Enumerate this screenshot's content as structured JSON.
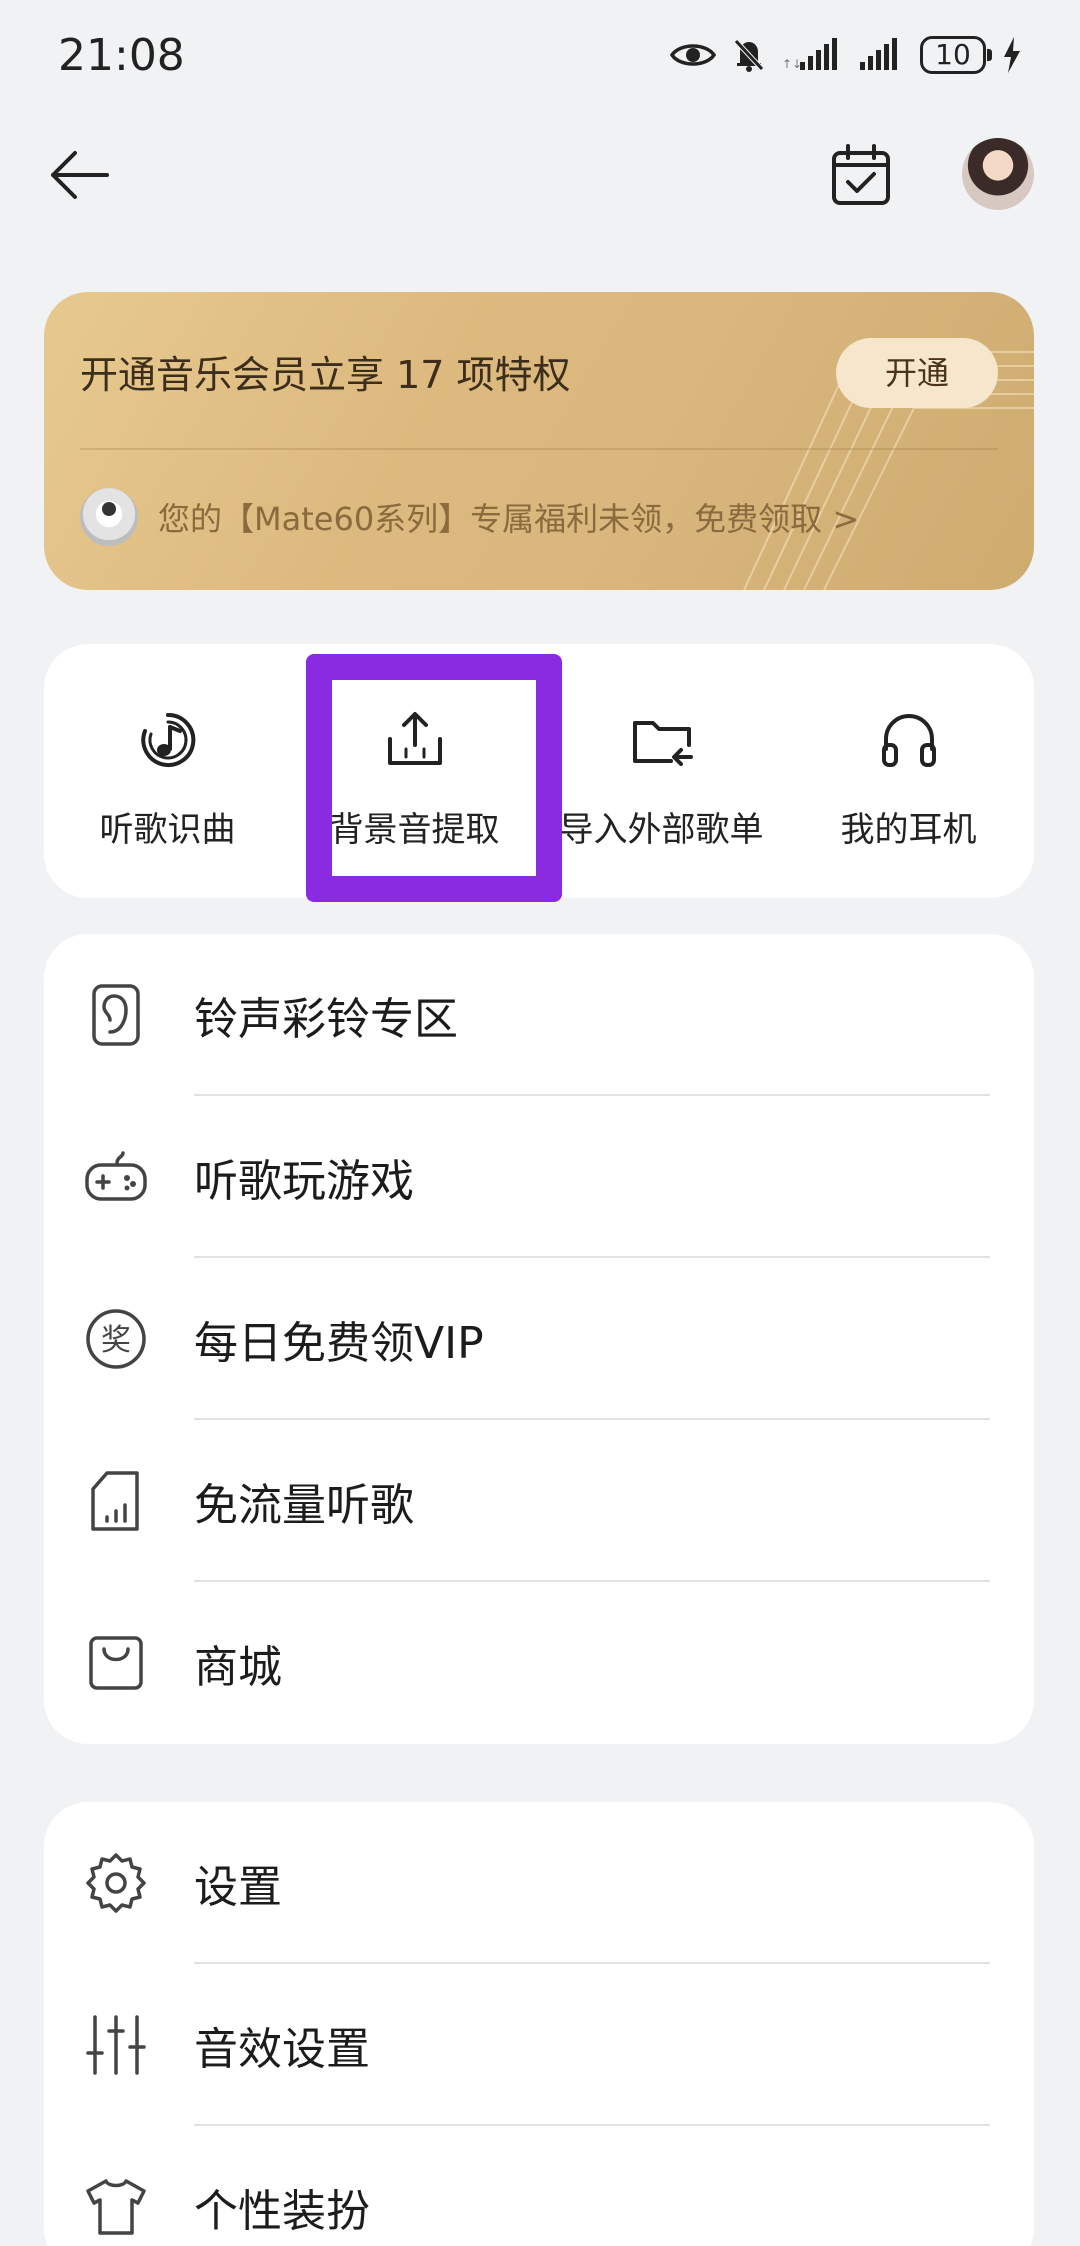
{
  "status_bar": {
    "time": "21:08",
    "battery": "10",
    "icons": [
      "eye-icon",
      "mute-bell-icon",
      "signal-icon",
      "signal-icon",
      "battery-icon",
      "charging-icon"
    ]
  },
  "top_bar": {
    "icons": [
      "back-arrow-icon",
      "calendar-check-icon",
      "avatar"
    ]
  },
  "vip_banner": {
    "title": "开通音乐会员立享 17 项特权",
    "open_button": "开通",
    "promo_text": "您的【Mate60系列】专属福利未领，免费领取 >"
  },
  "quick_actions": [
    {
      "label": "听歌识曲",
      "icon": "music-recognize-icon"
    },
    {
      "label": "背景音提取",
      "icon": "upload-extract-icon"
    },
    {
      "label": "导入外部歌单",
      "icon": "folder-import-icon"
    },
    {
      "label": "我的耳机",
      "icon": "headphones-icon"
    }
  ],
  "menu_group_1": [
    {
      "label": "铃声彩铃专区",
      "icon": "ringtone-icon"
    },
    {
      "label": "听歌玩游戏",
      "icon": "gamepad-icon"
    },
    {
      "label": "每日免费领VIP",
      "icon": "reward-icon"
    },
    {
      "label": "免流量听歌",
      "icon": "data-free-icon"
    },
    {
      "label": "商城",
      "icon": "shopping-bag-icon"
    }
  ],
  "menu_group_2": [
    {
      "label": "设置",
      "icon": "settings-gear-icon"
    },
    {
      "label": "音效设置",
      "icon": "equalizer-icon"
    },
    {
      "label": "个性装扮",
      "icon": "tshirt-icon"
    }
  ],
  "colors": {
    "highlight": "#8a2be2",
    "vip_gold": "#dcb97e",
    "background": "#f1f2f4"
  }
}
